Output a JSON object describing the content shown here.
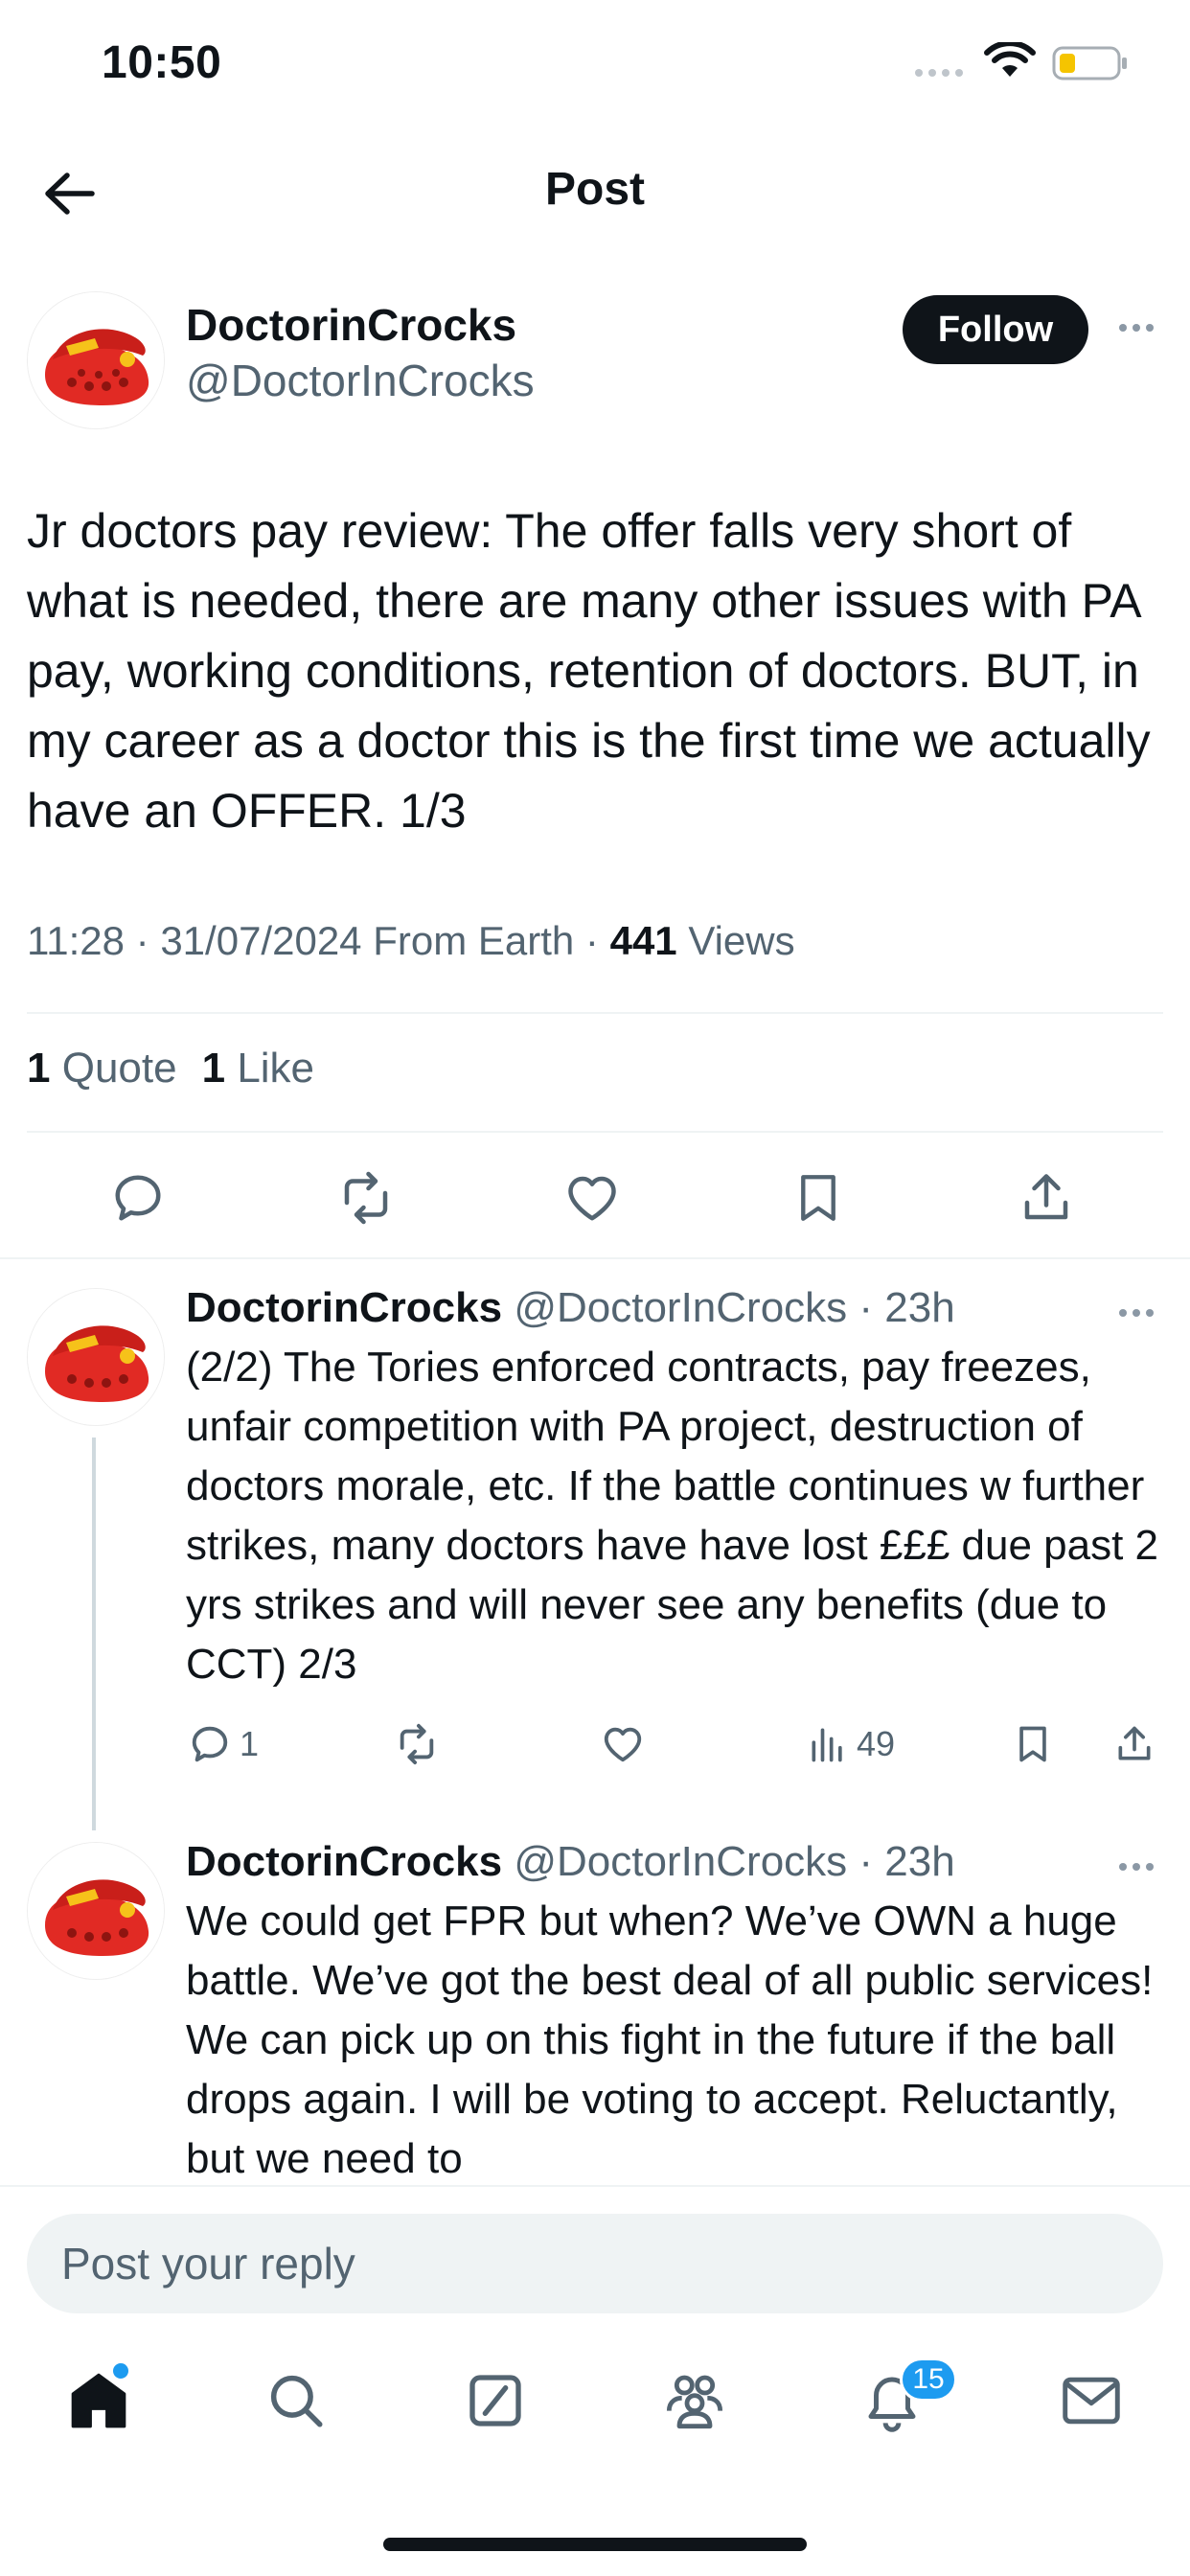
{
  "status": {
    "time": "10:50"
  },
  "header": {
    "title": "Post"
  },
  "post": {
    "author_name": "DoctorinCrocks",
    "author_handle": "@DoctorInCrocks",
    "follow_label": "Follow",
    "text": "Jr doctors pay review: The offer falls very short of what is needed, there are many other issues with PA pay, working conditions, retention of doctors. BUT, in my career as a doctor this is the first time we actually have an OFFER. 1/3",
    "time": "11:28",
    "date": "31/07/2024",
    "source": "From Earth",
    "views_count": "441",
    "views_label": "Views",
    "quotes_count": "1",
    "quotes_label": "Quote",
    "likes_count": "1",
    "likes_label": "Like"
  },
  "actions": {
    "icons": [
      "reply-icon",
      "repost-icon",
      "like-icon",
      "bookmark-icon",
      "share-icon"
    ]
  },
  "replies": [
    {
      "author_name": "DoctorinCrocks",
      "author_handle": "@DoctorInCrocks",
      "age": "23h",
      "text": "(2/2) The Tories enforced contracts, pay freezes, unfair competition with PA project, destruction of doctors morale, etc. If the battle continues w further strikes, many doctors have have lost £££ due past 2 yrs strikes and will never see any benefits (due to CCT) 2/3",
      "reply_count": "1",
      "views_count": "49"
    },
    {
      "author_name": "DoctorinCrocks",
      "author_handle": "@DoctorInCrocks",
      "age": "23h",
      "text": "We could get FPR but when? We’ve OWN a huge battle. We’ve got the best deal of all public services! We can pick up on this fight in the future if the ball drops again. I will be voting to accept. Reluctantly, but we need to"
    }
  ],
  "composer": {
    "placeholder": "Post your reply"
  },
  "nav": {
    "items": [
      "home-icon",
      "search-icon",
      "grok-icon",
      "communities-icon",
      "notifications-icon",
      "messages-icon"
    ],
    "notification_count": "15"
  },
  "colors": {
    "accent": "#1d9bf0",
    "text": "#0f1419",
    "muted": "#536471",
    "divider": "#eff3f4"
  }
}
